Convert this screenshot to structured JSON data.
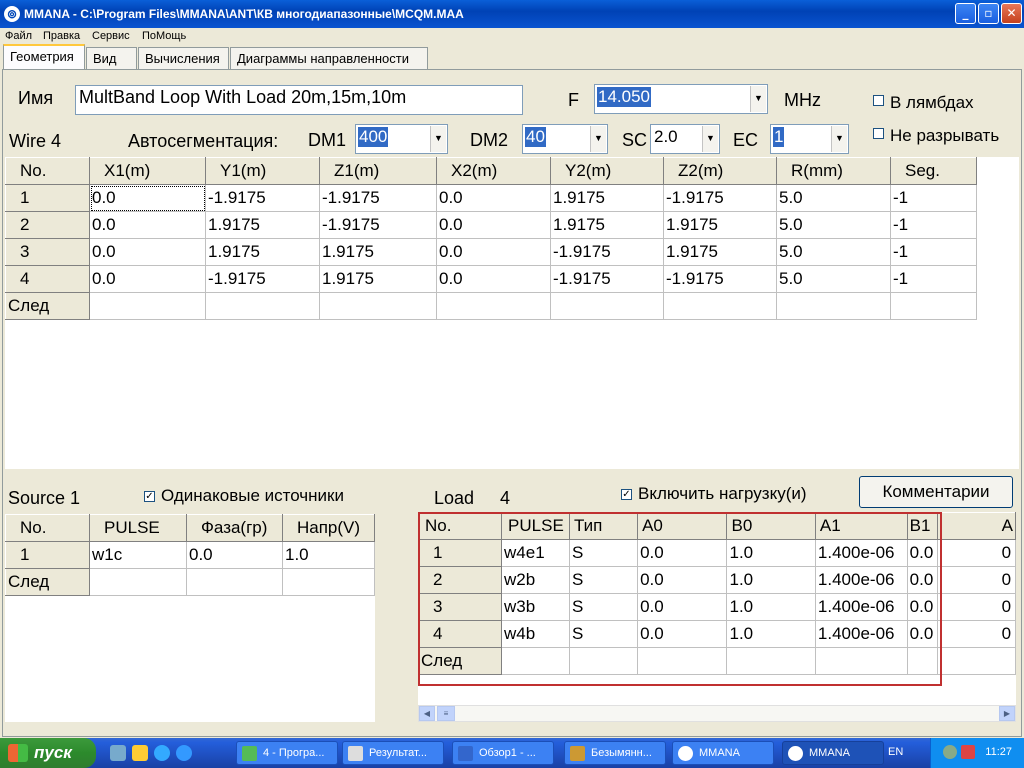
{
  "window": {
    "title": "MMANA - C:\\Program Files\\MMANA\\ANT\\КВ многодиапазонные\\MCQM.MAA",
    "min": "_",
    "max": "▫",
    "close": "✕"
  },
  "menu": [
    "Файл",
    "Правка",
    "Сервис",
    "ПоМощь"
  ],
  "tabs": [
    "Геометрия",
    "Вид",
    "Вычисления",
    "Диаграммы направленности"
  ],
  "geometry": {
    "name_label": "Имя",
    "name_value": "MultBand Loop With Load  20m,15m,10m",
    "f_label": "F",
    "f_value": "14.050",
    "mhz": "MHz",
    "lambda_check": "В лямбдах",
    "nobreak_check": "Не разрывать",
    "wire_label": "Wire 4",
    "autoseg_label": "Автосегментация:",
    "dm1_label": "DM1",
    "dm1_value": "400",
    "dm2_label": "DM2",
    "dm2_value": "40",
    "sc_label": "SC",
    "sc_value": "2.0",
    "ec_label": "EC",
    "ec_value": "1"
  },
  "wires": {
    "headers": [
      "No.",
      "X1(m)",
      "Y1(m)",
      "Z1(m)",
      "X2(m)",
      "Y2(m)",
      "Z2(m)",
      "R(mm)",
      "Seg."
    ],
    "rows": [
      [
        "1",
        "0.0",
        "-1.9175",
        "-1.9175",
        "0.0",
        "1.9175",
        "-1.9175",
        "5.0",
        "-1"
      ],
      [
        "2",
        "0.0",
        "1.9175",
        "-1.9175",
        "0.0",
        "1.9175",
        "1.9175",
        "5.0",
        "-1"
      ],
      [
        "3",
        "0.0",
        "1.9175",
        "1.9175",
        "0.0",
        "-1.9175",
        "1.9175",
        "5.0",
        "-1"
      ],
      [
        "4",
        "0.0",
        "-1.9175",
        "1.9175",
        "0.0",
        "-1.9175",
        "-1.9175",
        "5.0",
        "-1"
      ]
    ],
    "next": "След"
  },
  "source": {
    "label": "Source 1",
    "same_check": "Одинаковые источники",
    "headers": [
      "No.",
      "PULSE",
      "Фаза(гр)",
      "Напр(V)"
    ],
    "rows": [
      [
        "1",
        "w1c",
        "0.0",
        "1.0"
      ]
    ],
    "next": "След"
  },
  "load": {
    "label": "Load",
    "count": "4",
    "include_check": "Включить нагрузку(и)",
    "comments_button": "Комментарии",
    "headers": [
      "No.",
      "PULSE",
      "Тип",
      "A0",
      "B0",
      "A1",
      "B1",
      "A"
    ],
    "rows": [
      [
        "1",
        "w4e1",
        "S",
        "0.0",
        "1.0",
        "1.400e-06",
        "0.0",
        "0"
      ],
      [
        "2",
        "w2b",
        "S",
        "0.0",
        "1.0",
        "1.400e-06",
        "0.0",
        "0"
      ],
      [
        "3",
        "w3b",
        "S",
        "0.0",
        "1.0",
        "1.400e-06",
        "0.0",
        "0"
      ],
      [
        "4",
        "w4b",
        "S",
        "0.0",
        "1.0",
        "1.400e-06",
        "0.0",
        "0"
      ]
    ],
    "next": "След"
  },
  "taskbar": {
    "start": "пуск",
    "tasks": [
      "4 - Програ...",
      "Результат...",
      "Обзор1 - ...",
      "Безымянн...",
      "MMANA",
      "MMANA"
    ],
    "lang": "EN",
    "clock": "11:27"
  }
}
